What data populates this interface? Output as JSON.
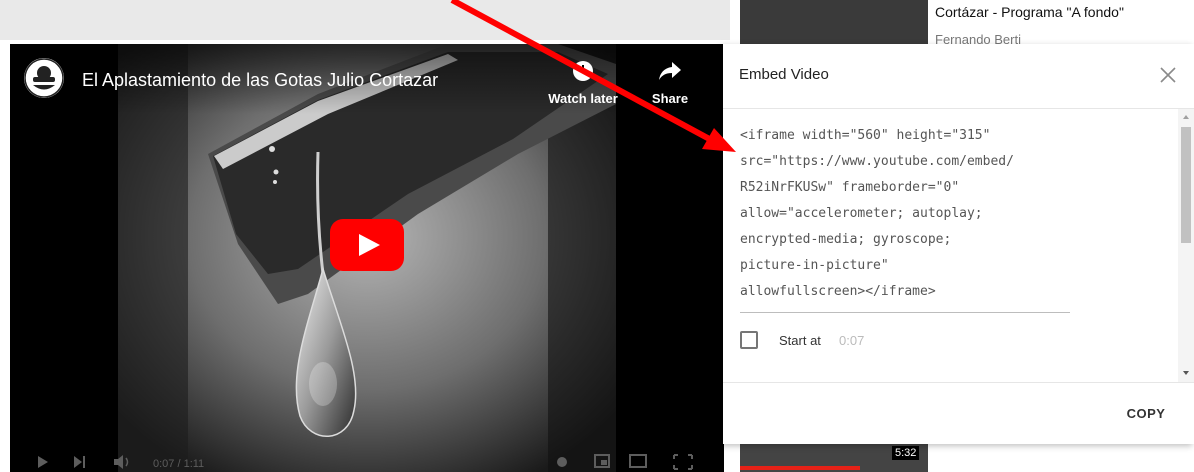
{
  "background_page": {
    "related_video_title": "Cortázar - Programa \"A fondo\"",
    "related_video_channel": "Fernando Berti",
    "bottom_thumbnail_duration": "5:32"
  },
  "player": {
    "video_title": "El Aplastamiento de las Gotas Julio Cortazar",
    "watch_later_label": "Watch later",
    "share_label": "Share",
    "current_time": "0:07 / 1:11",
    "colors": {
      "play_button_red": "#ff0000"
    }
  },
  "embed_dialog": {
    "title": "Embed Video",
    "code_lines": [
      "<iframe width=\"560\" height=\"315\"",
      "src=\"https://www.youtube.com/embed/",
      "R52iNrFKUSw\" frameborder=\"0\"",
      "allow=\"accelerometer; autoplay;",
      "encrypted-media; gyroscope;",
      "picture-in-picture\"",
      "allowfullscreen></iframe>"
    ],
    "start_at_label": "Start at",
    "start_at_time": "0:07",
    "copy_label": "COPY"
  },
  "annotation": {
    "arrow_color": "#ff0000"
  }
}
